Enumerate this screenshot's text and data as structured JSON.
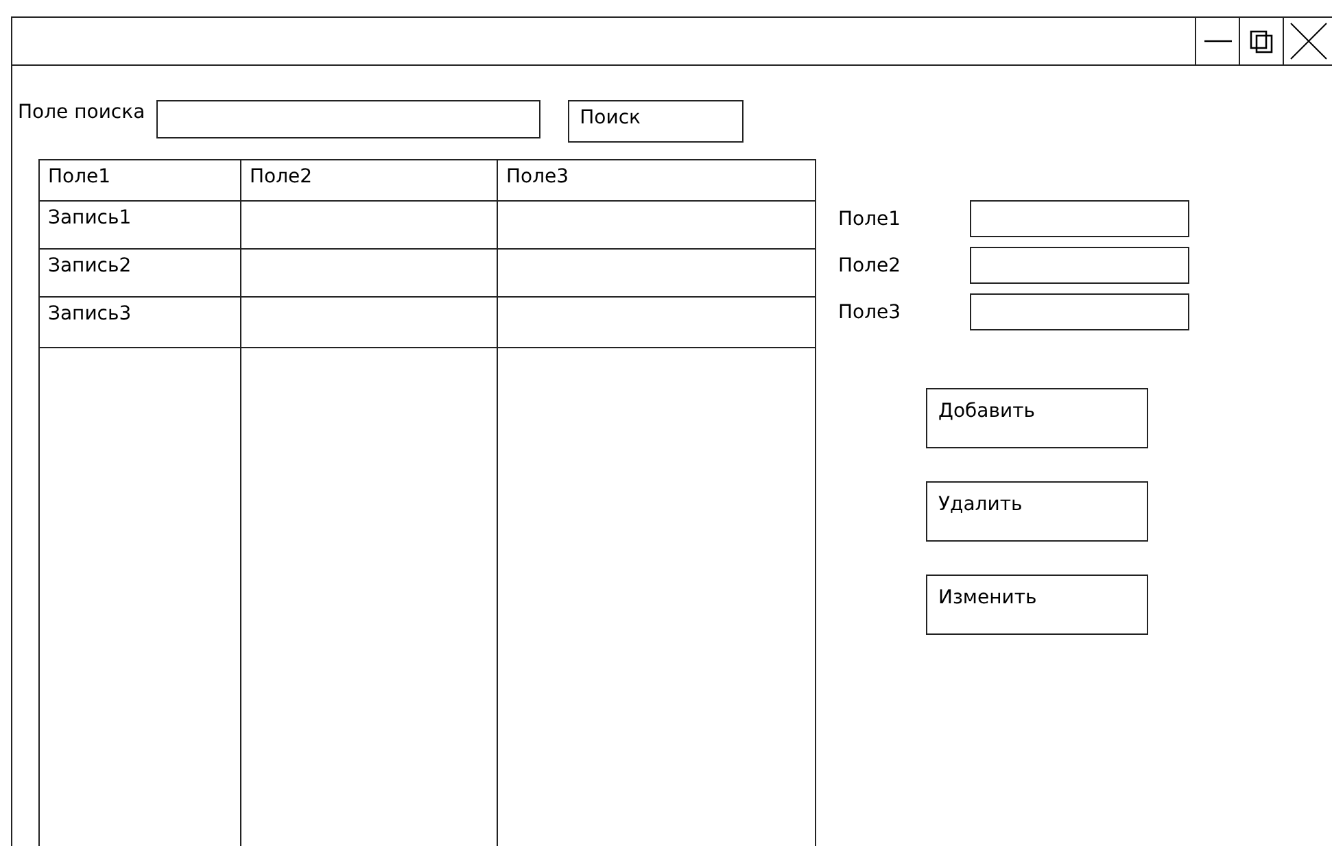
{
  "search": {
    "label": "Поле поиска",
    "button": "Поиск"
  },
  "table": {
    "columns": [
      "Поле1",
      "Поле2",
      "Поле3"
    ],
    "rows": [
      [
        "Запись1",
        "",
        ""
      ],
      [
        "Запись2",
        "",
        ""
      ],
      [
        "Запись3",
        "",
        ""
      ]
    ]
  },
  "form": {
    "fields": [
      {
        "label": "Поле1"
      },
      {
        "label": "Поле2"
      },
      {
        "label": "Поле3"
      }
    ],
    "buttons": [
      "Добавить",
      "Удалить",
      "Изменить"
    ]
  }
}
